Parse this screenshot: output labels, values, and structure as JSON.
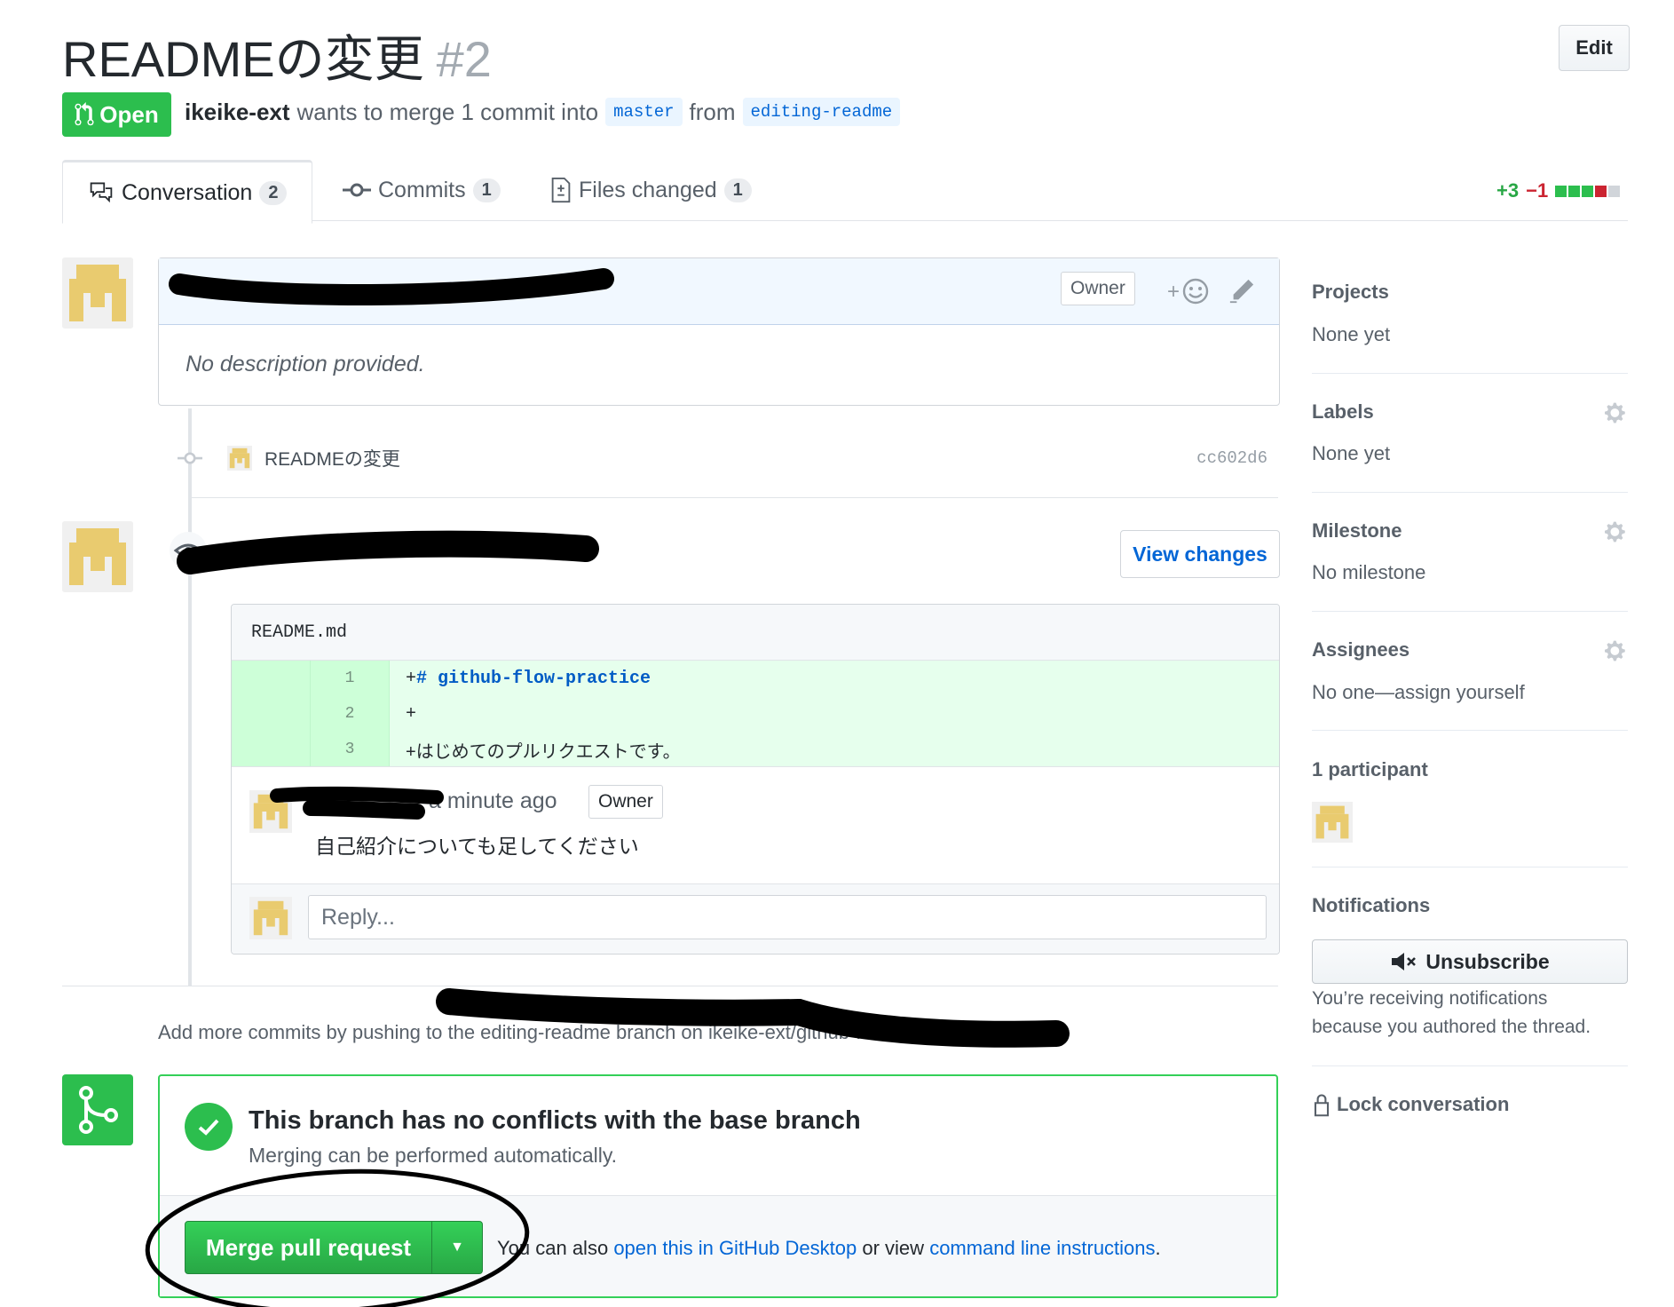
{
  "header": {
    "title": "READMEの変更",
    "number": "#2",
    "edit_label": "Edit",
    "state": "Open",
    "author": "ikeike-ext",
    "merge_text": "wants to merge 1 commit into",
    "base_branch": "master",
    "from_text": "from",
    "head_branch": "editing-readme"
  },
  "tabs": [
    {
      "label": "Conversation",
      "count": "2"
    },
    {
      "label": "Commits",
      "count": "1"
    },
    {
      "label": "Files changed",
      "count": "1"
    }
  ],
  "diffstat": {
    "additions": "+3",
    "deletions": "−1"
  },
  "first_comment": {
    "owner_label": "Owner",
    "body": "No description provided."
  },
  "commit": {
    "message": "READMEの変更",
    "sha": "cc602d6"
  },
  "review": {
    "view_changes_label": "View changes",
    "file": "README.md",
    "lines": [
      {
        "num": "1",
        "prefix": "+",
        "text": "# github-flow-practice"
      },
      {
        "num": "2",
        "prefix": "+",
        "text": ""
      },
      {
        "num": "3",
        "prefix": "+",
        "text": "はじめてのプルリクエストです。"
      }
    ],
    "comment_time": "a minute ago",
    "comment_owner_label": "Owner",
    "comment_body": "自己紹介についても足してください",
    "reply_placeholder": "Reply..."
  },
  "push_hint": "Add more commits by pushing to the editing-readme branch on ikeike-ext/github-flow-practice.",
  "merge": {
    "title": "This branch has no conflicts with the base branch",
    "subtitle": "Merging can be performed automatically.",
    "button_label": "Merge pull request",
    "note_prefix": "You can also",
    "desktop_link": "open this in GitHub Desktop",
    "note_middle": "or view",
    "cli_link": "command line instructions",
    "note_suffix": "."
  },
  "sidebar": {
    "projects": {
      "heading": "Projects",
      "value": "None yet"
    },
    "labels": {
      "heading": "Labels",
      "value": "None yet"
    },
    "milestone": {
      "heading": "Milestone",
      "value": "No milestone"
    },
    "assignees": {
      "heading": "Assignees",
      "value": "No one—assign yourself"
    },
    "participants": {
      "heading": "1 participant"
    },
    "notifications": {
      "heading": "Notifications",
      "button_label": "Unsubscribe",
      "reason_line1": "You’re receiving notifications",
      "reason_line2": "because you authored the thread."
    },
    "lock_label": "Lock conversation"
  },
  "colors": {
    "green": "#2cbe4e",
    "link": "#0366d6",
    "addition": "#28a745",
    "deletion": "#cb2431"
  }
}
